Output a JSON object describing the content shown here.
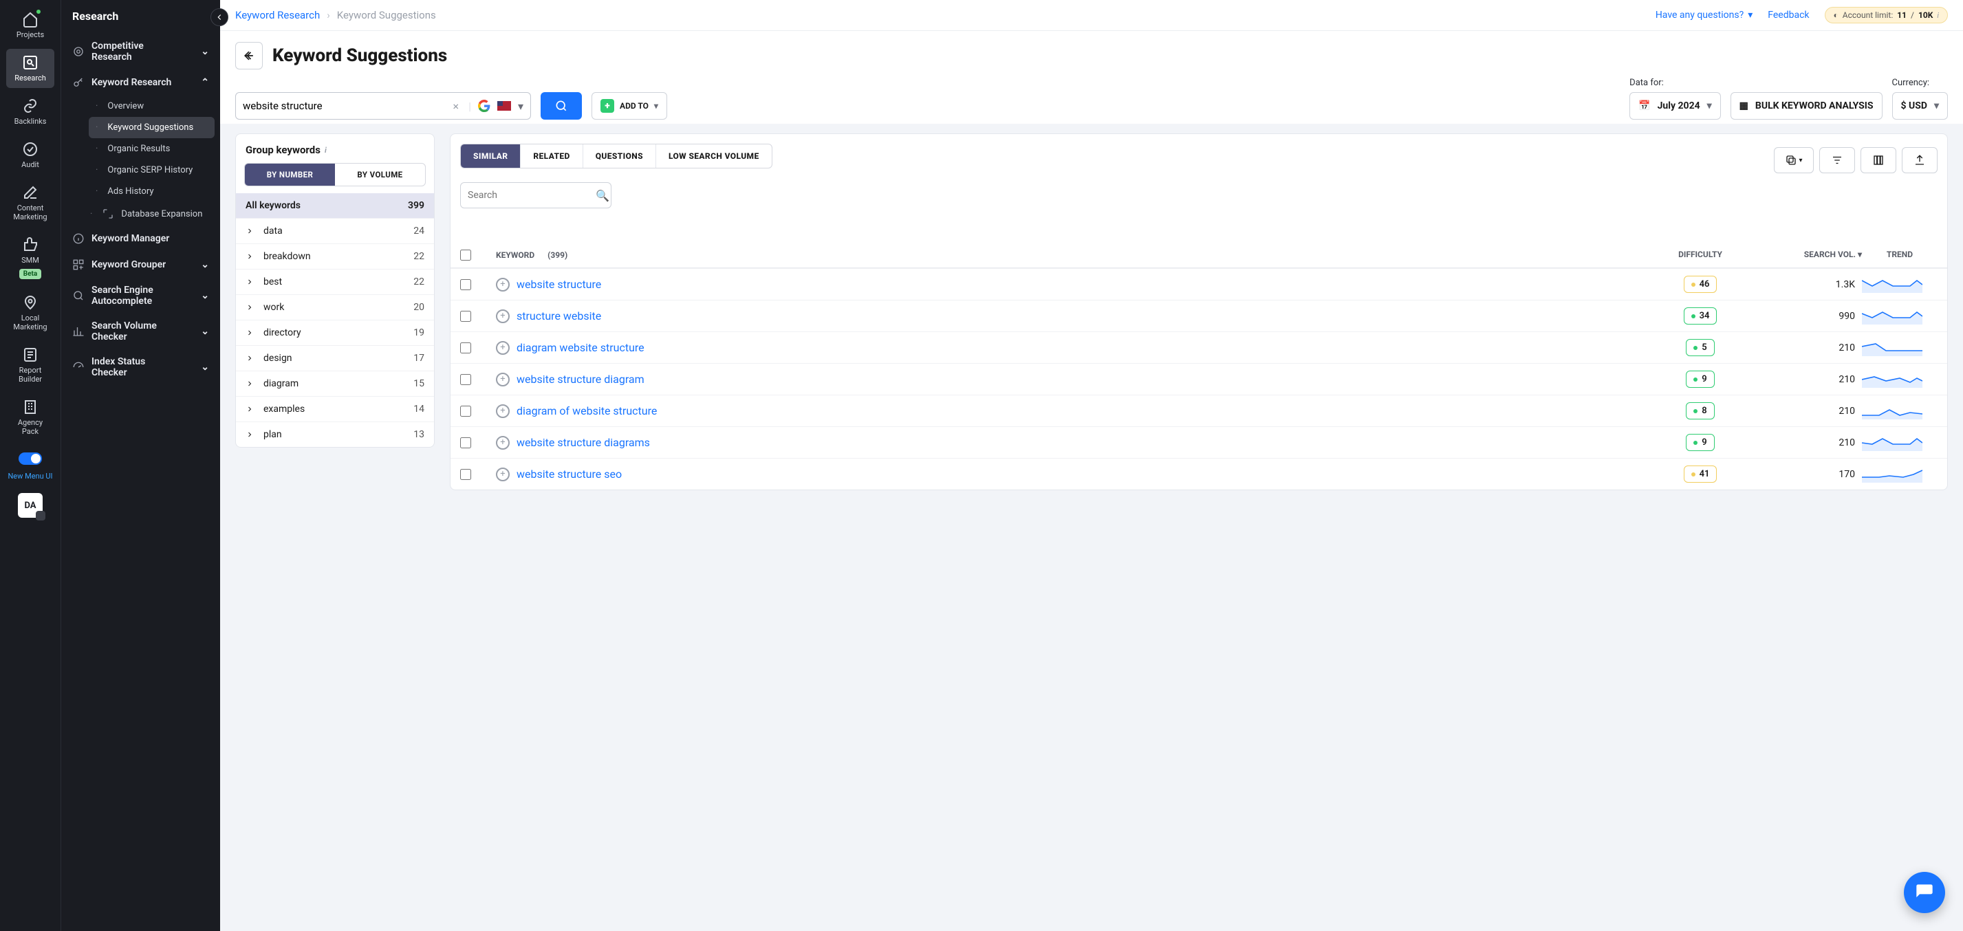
{
  "rail": {
    "projects": "Projects",
    "research": "Research",
    "backlinks": "Backlinks",
    "audit": "Audit",
    "content": "Content Marketing",
    "smm": "SMM",
    "beta": "Beta",
    "local": "Local Marketing",
    "report": "Report Builder",
    "agency": "Agency Pack",
    "newmenu": "New Menu UI",
    "avatar": "DA"
  },
  "sidebar": {
    "title": "Research",
    "competitive": "Competitive Research",
    "kr": "Keyword Research",
    "kr_items": [
      "Overview",
      "Keyword Suggestions",
      "Organic Results",
      "Organic SERP History",
      "Ads History",
      "Database Expansion"
    ],
    "km": "Keyword Manager",
    "kg": "Keyword Grouper",
    "sea": "Search Engine Autocomplete",
    "svc": "Search Volume Checker",
    "isc": "Index Status Checker"
  },
  "crumbs": {
    "a": "Keyword Research",
    "b": "Keyword Suggestions"
  },
  "header": {
    "questions": "Have any questions?",
    "feedback": "Feedback",
    "limit_label": "Account limit:",
    "limit_used": "11",
    "limit_sep": "/",
    "limit_total": "10K"
  },
  "hero": {
    "title": "Keyword Suggestions",
    "query": "website structure",
    "addto": "ADD TO",
    "data_for": "Data for:",
    "date": "July 2024",
    "bulk": "BULK KEYWORD ANALYSIS",
    "currency_label": "Currency:",
    "currency": "$ USD"
  },
  "group": {
    "title": "Group keywords",
    "by_number": "BY NUMBER",
    "by_volume": "BY VOLUME",
    "all": "All keywords",
    "all_count": "399",
    "rows": [
      {
        "k": "data",
        "c": "24"
      },
      {
        "k": "breakdown",
        "c": "22"
      },
      {
        "k": "best",
        "c": "22"
      },
      {
        "k": "work",
        "c": "20"
      },
      {
        "k": "directory",
        "c": "19"
      },
      {
        "k": "design",
        "c": "17"
      },
      {
        "k": "diagram",
        "c": "15"
      },
      {
        "k": "examples",
        "c": "14"
      },
      {
        "k": "plan",
        "c": "13"
      }
    ]
  },
  "tabs": [
    "SIMILAR",
    "RELATED",
    "QUESTIONS",
    "LOW SEARCH VOLUME"
  ],
  "search_placeholder": "Search",
  "table": {
    "head": {
      "keyword": "KEYWORD",
      "count": "(399)",
      "difficulty": "DIFFICULTY",
      "search": "SEARCH VOL.",
      "trend": "TREND"
    },
    "rows": [
      {
        "k": "website structure",
        "d": "46",
        "dc": "yellow",
        "v": "1.3K"
      },
      {
        "k": "structure website",
        "d": "34",
        "dc": "green",
        "v": "990"
      },
      {
        "k": "diagram website structure",
        "d": "5",
        "dc": "green",
        "v": "210"
      },
      {
        "k": "website structure diagram",
        "d": "9",
        "dc": "green",
        "v": "210"
      },
      {
        "k": "diagram of website structure",
        "d": "8",
        "dc": "green",
        "v": "210"
      },
      {
        "k": "website structure diagrams",
        "d": "9",
        "dc": "green",
        "v": "210"
      },
      {
        "k": "website structure seo",
        "d": "41",
        "dc": "yellow",
        "v": "170"
      }
    ]
  }
}
